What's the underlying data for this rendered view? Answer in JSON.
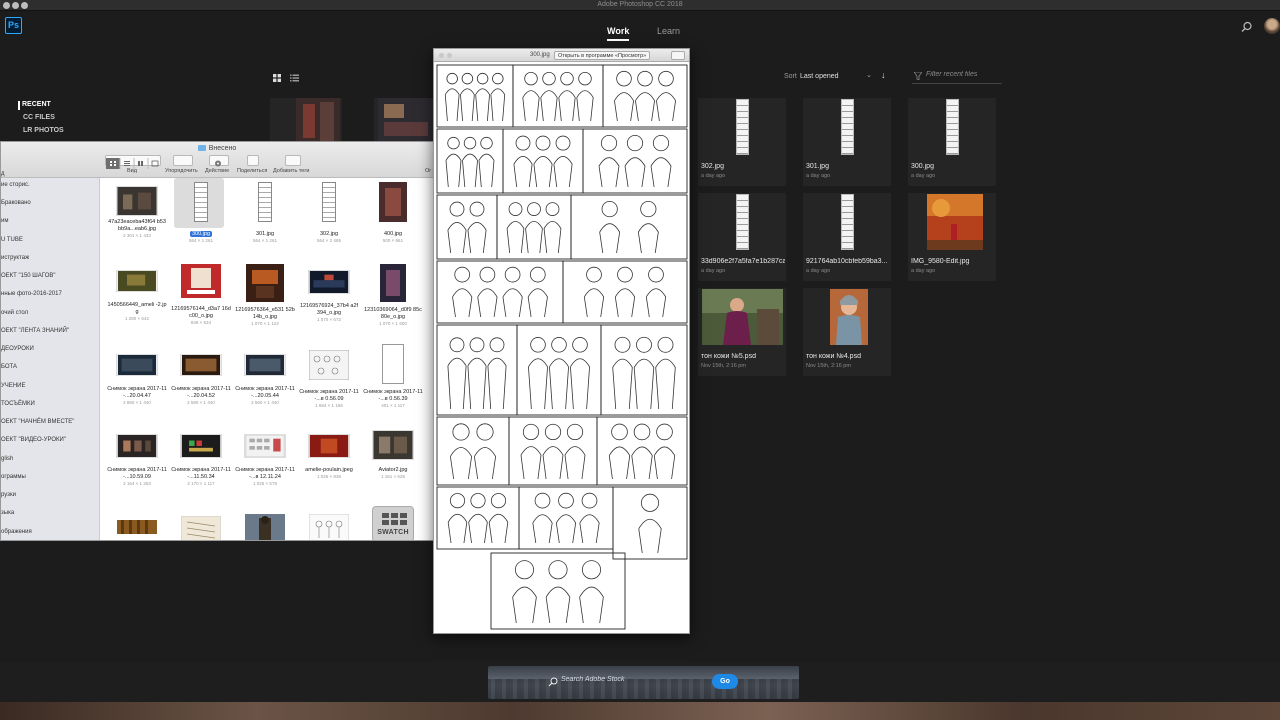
{
  "app": {
    "window_title": "Adobe Photoshop CC 2018",
    "logo_text": "Ps"
  },
  "header": {
    "tabs": [
      "Work",
      "Learn"
    ]
  },
  "nav": {
    "items": [
      "RECENT",
      "CC FILES",
      "LR PHOTOS"
    ]
  },
  "sort": {
    "label": "Sort",
    "value": "Last opened"
  },
  "filter": {
    "placeholder": "Filter recent files"
  },
  "recent_files": [
    {
      "name": "302.jpg",
      "date": "a day ago",
      "kind": "doc"
    },
    {
      "name": "301.jpg",
      "date": "a day ago",
      "kind": "doc"
    },
    {
      "name": "300.jpg",
      "date": "a day ago",
      "kind": "doc"
    },
    {
      "name": "33d906e2f7a5fa7e1b287ca...",
      "date": "a day ago",
      "kind": "doc"
    },
    {
      "name": "921764ab10cbfeb59ba3...",
      "date": "a day ago",
      "kind": "doc"
    },
    {
      "name": "IMG_9580-Edit.jpg",
      "date": "a day ago",
      "kind": "photo"
    },
    {
      "name": "тон кожи №5.psd",
      "date": "Nov 15th, 2:16 pm",
      "kind": "photo"
    },
    {
      "name": "тон кожи №4.psd",
      "date": "Nov 15th, 2:16 pm",
      "kind": "photo"
    }
  ],
  "finder": {
    "title": "Внесено",
    "toolbar": [
      "Вид",
      "Упорядочить",
      "Действие",
      "Поделиться",
      "Добавить теги"
    ],
    "toolbar_right": "Or",
    "sidebar": [
      "ие сторис.",
      "Бракованo",
      "им",
      "U TUBE",
      "иструктаж",
      "ОЕКТ \"150 ШАГОВ\"",
      "нные фото-2016-2017",
      "очий стол",
      "ОЕКТ \"ЛЕНТА ЗНАНИЙ\"",
      "ДЕОУРОКИ",
      "БОТА",
      "УЧЕНИЕ",
      "ТОСЪЁМКИ",
      "ОЕКТ \"НАЧНЁМ ВМЕСТЕ\"",
      "ОЕКТ \"ВИДЕО-УРОКИ\"",
      "glish",
      "ограммы",
      "рузки",
      "зыка",
      "ображения"
    ],
    "side_top_label": "д",
    "files": [
      {
        "name": "47a23eaceba43f64 b53bb9a...eab6.jpg",
        "meta": "2 301 × 1 433"
      },
      {
        "name": "300.jpg",
        "meta": "564 × 1 261",
        "selected": true
      },
      {
        "name": "301.jpg",
        "meta": "564 × 1 261"
      },
      {
        "name": "302.jpg",
        "meta": "564 × 2 485"
      },
      {
        "name": "400.jpg",
        "meta": "500 × 661"
      },
      {
        "name": "1450566449_ameli -2.jpg",
        "meta": "1 280 × 642"
      },
      {
        "name": "12169576144_d3a7 16dc00_o.jpg",
        "meta": "848 × 534"
      },
      {
        "name": "12169576364_e531 52b14b_o.jpg",
        "meta": "1 070 × 1 122"
      },
      {
        "name": "12169576924_37b4 a2f394_o.jpg",
        "meta": "1 070 × 672"
      },
      {
        "name": "12310369064_d0f9 85c80e_o.jpg",
        "meta": "1 070 × 1 600"
      },
      {
        "name": "Снимок экрана 2017-11-...20.04.47",
        "meta": "2 880 × 1 440"
      },
      {
        "name": "Снимок экрана 2017-11-...20.04.52",
        "meta": "2 580 × 1 440"
      },
      {
        "name": "Снимок экрана 2017-11-...20.05.44",
        "meta": "2 560 × 1 440"
      },
      {
        "name": "Снимок экрана 2017-11-...в 0.56.09",
        "meta": "1 684 × 1 186"
      },
      {
        "name": "Снимок экрана 2017-11-...в 0.56.39",
        "meta": "401 × 1 117"
      },
      {
        "name": "Снимок экрана 2017-11-...10.59.09",
        "meta": "2 164 × 1 263"
      },
      {
        "name": "Снимок экрана 2017-11-...11.50.34",
        "meta": "2 170 × 1 117"
      },
      {
        "name": "Снимок экрана 2017-11-...в 12.11.24",
        "meta": "1 025 × 578"
      },
      {
        "name": "amelie-poulain.jpeg",
        "meta": "1 026 × 836"
      },
      {
        "name": "Aviator2.jpg",
        "meta": "1 161 × 625"
      }
    ],
    "swatch_label": "SWATCH"
  },
  "preview": {
    "filename": "300.jpg",
    "open_button": "Открыть в программе «Просмотр»"
  },
  "stock": {
    "placeholder": "Search Adobe Stock",
    "go_label": "Go"
  },
  "colors": {
    "accent": "#31a8ff",
    "go_button": "#1f8ae6",
    "selection": "#2f73d8"
  }
}
